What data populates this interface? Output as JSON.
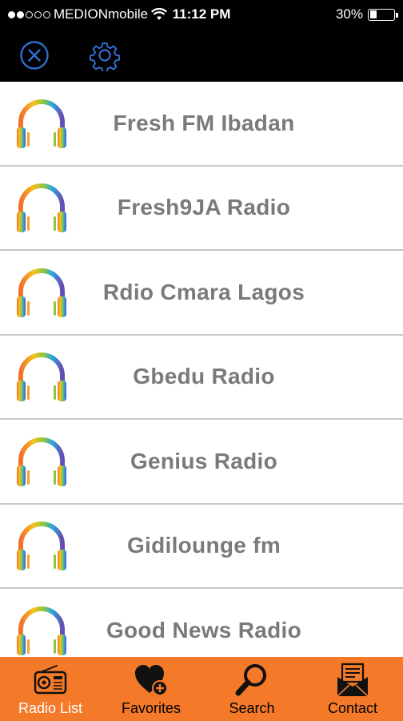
{
  "status_bar": {
    "carrier": "MEDIONmobile",
    "time": "11:12 PM",
    "battery": "30%",
    "battery_level": 0.3
  },
  "toolbar": {
    "close_icon": "close-circle-icon",
    "settings_icon": "gear-icon",
    "accent": "#2f6fd1"
  },
  "radio_list": {
    "items": [
      {
        "name": "Fresh FM Ibadan"
      },
      {
        "name": "Fresh9JA Radio"
      },
      {
        "name": "Rdio Cmara Lagos"
      },
      {
        "name": "Gbedu Radio"
      },
      {
        "name": "Genius Radio"
      },
      {
        "name": "Gidilounge fm"
      },
      {
        "name": "Good News Radio"
      }
    ]
  },
  "tab_bar": {
    "background": "#f47a2a",
    "tabs": [
      {
        "label": "Radio List",
        "icon": "radio-icon",
        "active": true
      },
      {
        "label": "Favorites",
        "icon": "heart-plus-icon",
        "active": false
      },
      {
        "label": "Search",
        "icon": "magnifier-icon",
        "active": false
      },
      {
        "label": "Contact",
        "icon": "envelope-icon",
        "active": false
      }
    ]
  }
}
